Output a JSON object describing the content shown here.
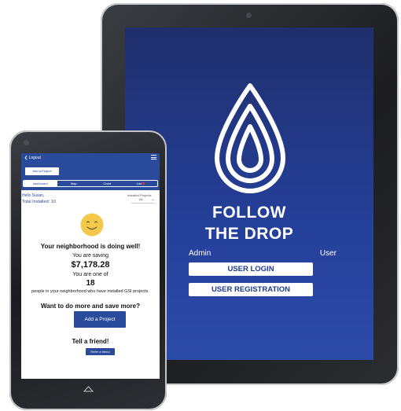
{
  "tablet": {
    "app_name_line1": "FOLLOW",
    "app_name_line2": "THE DROP",
    "admin_label": "Admin",
    "user_label": "User",
    "login_button": "USER LOGIN",
    "register_button": "USER REGISTRATION"
  },
  "phone": {
    "header": {
      "logout_label": "Logout",
      "add_project_label": "Add a Project"
    },
    "tabs": [
      {
        "label": "dashboard",
        "active": true
      },
      {
        "label": "Map",
        "active": false
      },
      {
        "label": "Chart",
        "active": false
      },
      {
        "label": "List",
        "active": false,
        "badge": true
      }
    ],
    "greeting": "Hello Susan,",
    "total_installed": "Total Installed: 10",
    "installed_projects_label": "Installed Projects",
    "installed_projects_value": "All",
    "status_message": "Your neighborhood is doing well!",
    "saving_label": "You are saving",
    "saving_amount": "$7,178.28",
    "rank_label": "You are one of",
    "rank_count": "18",
    "rank_description": "people in your neighborhood who have installed GSI projects.",
    "cta_question": "Want to do more and save more?",
    "add_project_button": "Add a Project",
    "tell_friend": "Tell a friend!",
    "refer_button": "Refer a friend"
  },
  "colors": {
    "brand_blue": "#2a4a9b",
    "tablet_bg": "#25409a",
    "badge_red": "#e63b2e",
    "smiley": "#f4c84a"
  }
}
